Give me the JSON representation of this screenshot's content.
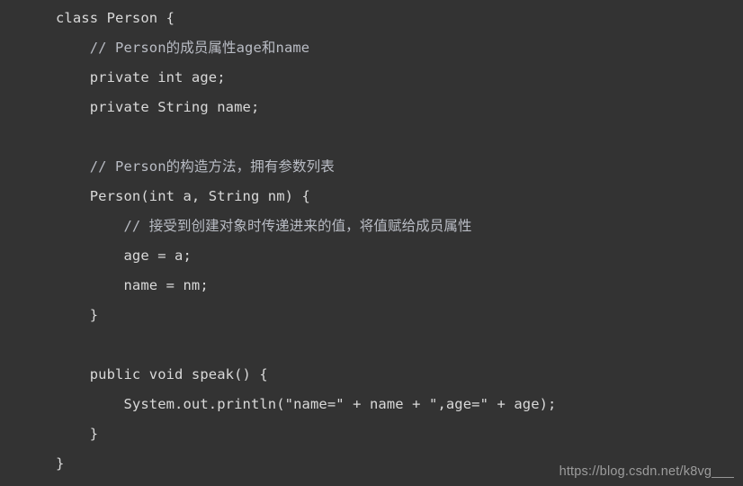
{
  "editor": {
    "background_color": "#333333",
    "code_color": "#d9d9d9",
    "comment_color": "#b9bcc4",
    "language": "java",
    "lines": [
      {
        "indent": 0,
        "type": "code",
        "text": "class Person {"
      },
      {
        "indent": 1,
        "type": "comment",
        "text": "// Person的成员属性age和name"
      },
      {
        "indent": 1,
        "type": "code",
        "text": "private int age;"
      },
      {
        "indent": 1,
        "type": "code",
        "text": "private String name;"
      },
      {
        "indent": 0,
        "type": "blank",
        "text": ""
      },
      {
        "indent": 1,
        "type": "comment",
        "text": "// Person的构造方法，拥有参数列表"
      },
      {
        "indent": 1,
        "type": "code",
        "text": "Person(int a, String nm) {"
      },
      {
        "indent": 2,
        "type": "comment",
        "text": "// 接受到创建对象时传递进来的值，将值赋给成员属性"
      },
      {
        "indent": 2,
        "type": "code",
        "text": "age = a;"
      },
      {
        "indent": 2,
        "type": "code",
        "text": "name = nm;"
      },
      {
        "indent": 1,
        "type": "code",
        "text": "}"
      },
      {
        "indent": 0,
        "type": "blank",
        "text": ""
      },
      {
        "indent": 1,
        "type": "code",
        "text": "public void speak() {"
      },
      {
        "indent": 2,
        "type": "code",
        "text": "System.out.println(\"name=\" + name + \",age=\" + age);"
      },
      {
        "indent": 1,
        "type": "code",
        "text": "}"
      },
      {
        "indent": 0,
        "type": "code",
        "text": "}"
      }
    ]
  },
  "watermark": {
    "text": "https://blog.csdn.net/k8vg___",
    "color": "#9c9c9c"
  }
}
